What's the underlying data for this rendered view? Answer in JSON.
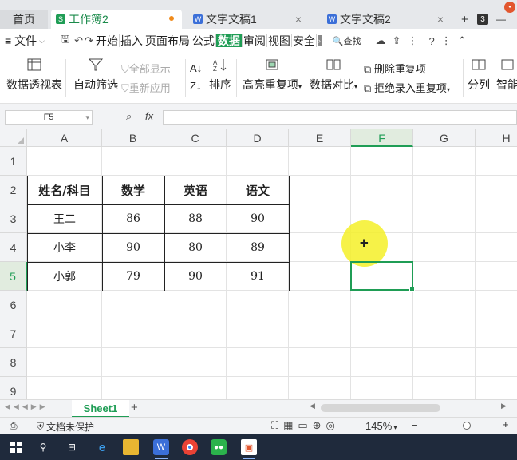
{
  "tabs": {
    "home": "首页",
    "active": "工作簿2",
    "doc1": "文字文稿1",
    "doc2": "文字文稿2",
    "add": "+",
    "count": "3"
  },
  "menu": {
    "file": "文件",
    "items": [
      "开始",
      "插入",
      "页面布局",
      "公式",
      "数据",
      "审阅",
      "视图",
      "安全"
    ],
    "active_index": 4,
    "search": "查找"
  },
  "ribbon": {
    "pivot": "数据透视表",
    "autofilter": "自动筛选",
    "show_all": "全部显示",
    "reapply": "重新应用",
    "sort": "排序",
    "highlight_dup": "高亮重复项",
    "compare": "数据对比",
    "remove_dup": "删除重复项",
    "reject_dup": "拒绝录入重复项",
    "split": "分列",
    "smart": "智能"
  },
  "formula": {
    "namebox": "F5",
    "fx": "fx",
    "value": ""
  },
  "columns": [
    "A",
    "B",
    "C",
    "D",
    "E",
    "F",
    "G",
    "H"
  ],
  "selected_column": "F",
  "rows": [
    "1",
    "2",
    "3",
    "4",
    "5",
    "6",
    "7",
    "8",
    "9"
  ],
  "selected_row": "5",
  "table": {
    "headers": [
      "姓名/科目",
      "数学",
      "英语",
      "语文"
    ],
    "data": [
      [
        "王二",
        "86",
        "88",
        "90"
      ],
      [
        "小李",
        "90",
        "80",
        "89"
      ],
      [
        "小郭",
        "79",
        "90",
        "91"
      ]
    ]
  },
  "sheets": {
    "active": "Sheet1",
    "add": "+"
  },
  "status": {
    "protect": "文档未保护",
    "zoom": "145%"
  },
  "colors": {
    "accent": "#1f9d55",
    "taskbar": "#1f2a3c"
  }
}
